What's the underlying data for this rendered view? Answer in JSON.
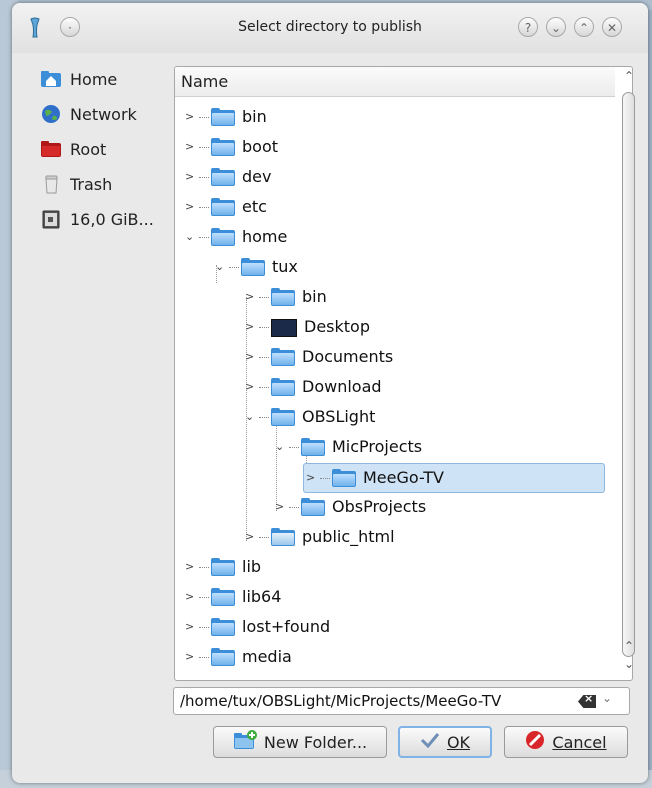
{
  "window": {
    "title": "Select directory to publish"
  },
  "titlebar_buttons": [
    "?",
    "⌄",
    "⌃",
    "✕"
  ],
  "places": [
    {
      "label": "Home",
      "icon": "home-folder-icon"
    },
    {
      "label": "Network",
      "icon": "network-globe-icon"
    },
    {
      "label": "Root",
      "icon": "root-folder-icon"
    },
    {
      "label": "Trash",
      "icon": "trash-icon"
    },
    {
      "label": "16,0 GiB...",
      "icon": "drive-icon"
    }
  ],
  "tree": {
    "column_header": "Name",
    "rows": [
      {
        "label": "bin",
        "expander": ">",
        "depth": 0
      },
      {
        "label": "boot",
        "expander": ">",
        "depth": 0
      },
      {
        "label": "dev",
        "expander": ">",
        "depth": 0
      },
      {
        "label": "etc",
        "expander": ">",
        "depth": 0
      },
      {
        "label": "home",
        "expander": "⌄",
        "depth": 0
      },
      {
        "label": "tux",
        "expander": "⌄",
        "depth": 1
      },
      {
        "label": "bin",
        "expander": ">",
        "depth": 2
      },
      {
        "label": "Desktop",
        "expander": ">",
        "depth": 2
      },
      {
        "label": "Documents",
        "expander": ">",
        "depth": 2
      },
      {
        "label": "Download",
        "expander": ">",
        "depth": 2
      },
      {
        "label": "OBSLight",
        "expander": "⌄",
        "depth": 2
      },
      {
        "label": "MicProjects",
        "expander": "⌄",
        "depth": 3
      },
      {
        "label": "MeeGo-TV",
        "expander": ">",
        "depth": 4,
        "selected": true
      },
      {
        "label": "ObsProjects",
        "expander": ">",
        "depth": 3
      },
      {
        "label": "public_html",
        "expander": ">",
        "depth": 2
      },
      {
        "label": "lib",
        "expander": ">",
        "depth": 0
      },
      {
        "label": "lib64",
        "expander": ">",
        "depth": 0
      },
      {
        "label": "lost+found",
        "expander": ">",
        "depth": 0
      },
      {
        "label": "media",
        "expander": ">",
        "depth": 0
      }
    ]
  },
  "path_field": {
    "value": "/home/tux/OBSLight/MicProjects/MeeGo-TV"
  },
  "buttons": {
    "new_folder": "New Folder...",
    "ok": "OK",
    "cancel": "Cancel"
  },
  "colors": {
    "folder_blue": "#3d8ed8",
    "selection": "#cfe3f6",
    "cancel_red": "#d9262b"
  }
}
